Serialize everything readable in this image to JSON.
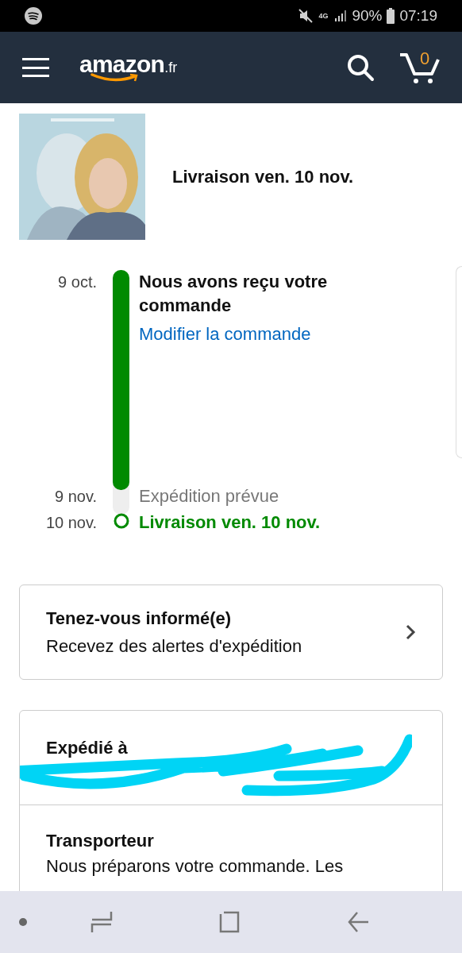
{
  "status_bar": {
    "battery": "90%",
    "time": "07:19",
    "network": "4G"
  },
  "header": {
    "logo": "amazon",
    "logo_suffix": ".fr",
    "cart_count": "0"
  },
  "product": {
    "delivery": "Livraison ven. 10 nov."
  },
  "timeline": {
    "level": 0.9,
    "steps": [
      {
        "kind": "done",
        "date": "9 oct.",
        "title": "Nous avons reçu votre commande",
        "link": "Modifier la commande"
      },
      {
        "kind": "pending",
        "date": "9 nov.",
        "title": "Expédition prévue"
      },
      {
        "kind": "target",
        "date": "10 nov.",
        "title": "Livraison ven. 10 nov."
      }
    ]
  },
  "alerts_card": {
    "title": "Tenez-vous informé(e)",
    "subtitle": "Recevez des alertes d'expédition"
  },
  "details": [
    {
      "title": "Expédié à"
    },
    {
      "title": "Transporteur",
      "text": "Nous préparons votre commande. Les"
    }
  ]
}
